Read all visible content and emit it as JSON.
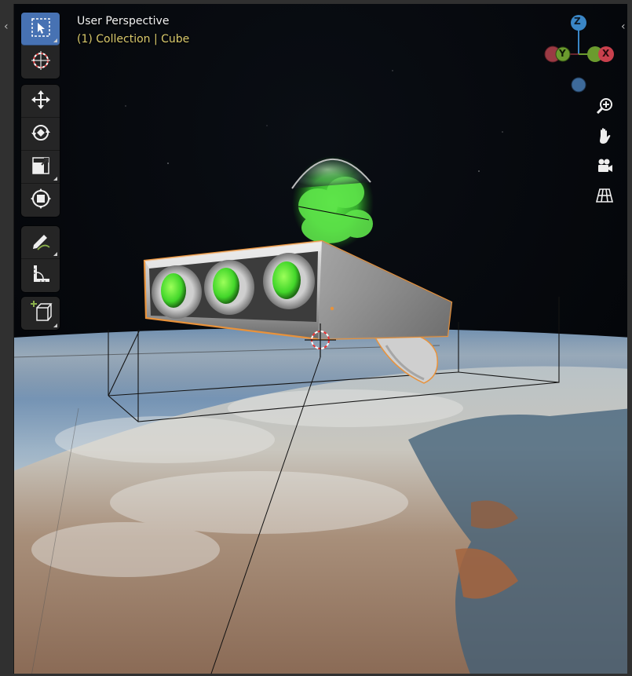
{
  "viewport": {
    "title": "User Perspective",
    "subtitle": "(1) Collection | Cube"
  },
  "toolbar": {
    "tools": [
      {
        "name": "select-box-tool",
        "icon": "cursor-select-icon",
        "active": true
      },
      {
        "name": "cursor-tool",
        "icon": "3d-cursor-icon",
        "active": false
      },
      {
        "name": "move-tool",
        "icon": "move-arrows-icon",
        "active": false
      },
      {
        "name": "rotate-tool",
        "icon": "rotate-icon",
        "active": false
      },
      {
        "name": "scale-tool",
        "icon": "scale-icon",
        "active": false
      },
      {
        "name": "transform-tool",
        "icon": "transform-icon",
        "active": false
      },
      {
        "name": "annotate-tool",
        "icon": "annotate-pencil-icon",
        "active": false
      },
      {
        "name": "measure-tool",
        "icon": "measure-ruler-icon",
        "active": false
      },
      {
        "name": "add-cube-tool",
        "icon": "add-cube-icon",
        "active": false
      }
    ]
  },
  "gizmo": {
    "z_label": "Z",
    "y_label": "Y",
    "x_label": "X",
    "colors": {
      "x": "#c9404d",
      "y": "#6b9b2e",
      "z": "#3a86c6",
      "neg": "#3d6a9a"
    }
  },
  "nav_buttons": [
    {
      "name": "zoom-button",
      "icon": "zoom-in-icon"
    },
    {
      "name": "pan-button",
      "icon": "hand-icon"
    },
    {
      "name": "camera-view-button",
      "icon": "camera-icon"
    },
    {
      "name": "toggle-perspective-button",
      "icon": "grid-icon"
    }
  ],
  "colors": {
    "active_tool": "#4772b3",
    "selection_outline": "#e8923b",
    "header_sub": "#d9c96b"
  }
}
